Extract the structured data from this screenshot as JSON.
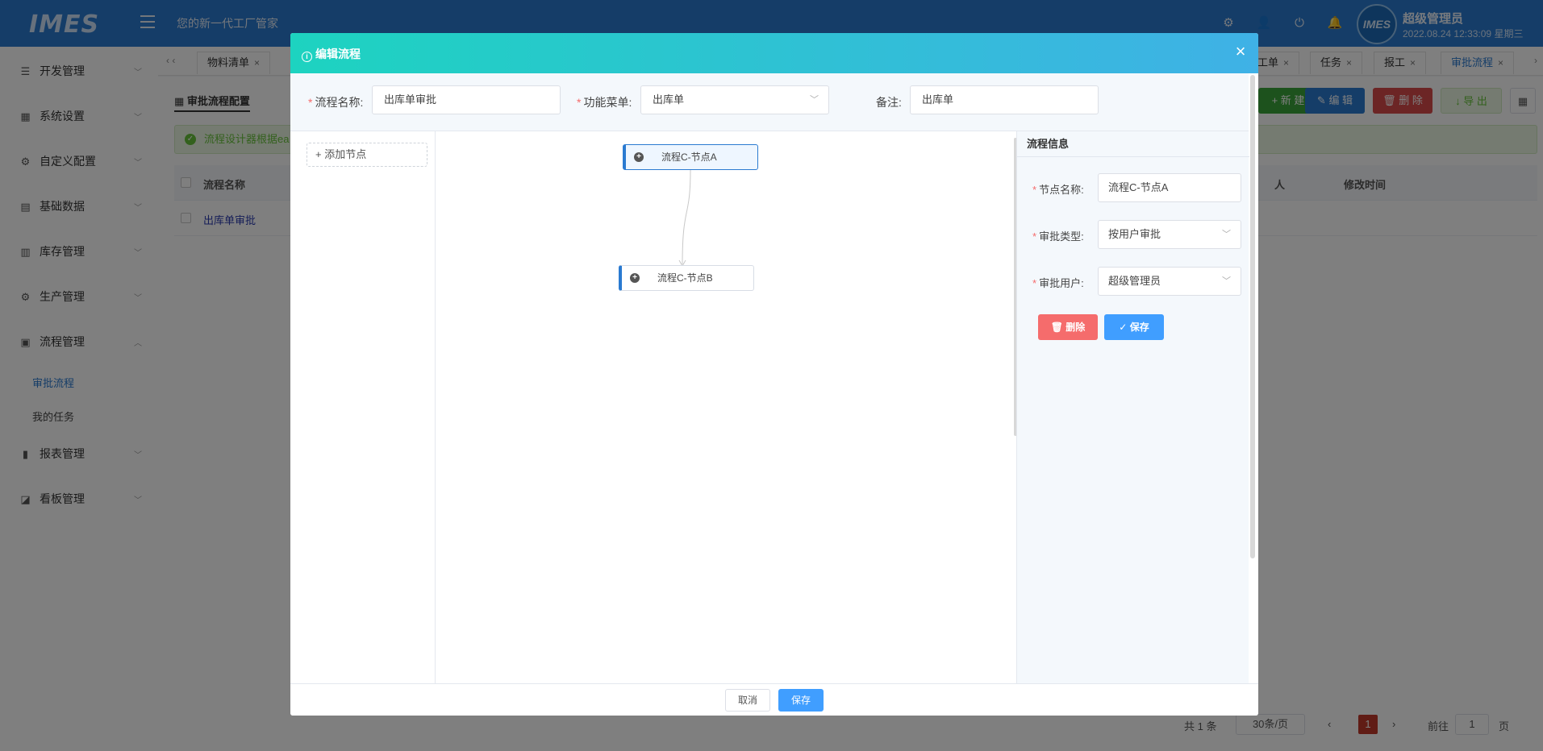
{
  "header": {
    "logo": "IMES",
    "slogan": "您的新一代工厂管家",
    "user_name": "超级管理员",
    "user_time": "2022.08.24 12:33:09 星期三",
    "avatar_text": "IMES"
  },
  "sidebar": {
    "items": [
      {
        "label": "开发管理"
      },
      {
        "label": "系统设置"
      },
      {
        "label": "自定义配置"
      },
      {
        "label": "基础数据"
      },
      {
        "label": "库存管理"
      },
      {
        "label": "生产管理"
      },
      {
        "label": "流程管理"
      },
      {
        "label": "报表管理"
      },
      {
        "label": "看板管理"
      }
    ],
    "sub_items": [
      {
        "label": "审批流程"
      },
      {
        "label": "我的任务"
      }
    ]
  },
  "tabs": {
    "left": [
      "物料清单"
    ],
    "right": [
      "工单",
      "任务",
      "报工",
      "审批流程"
    ]
  },
  "page": {
    "title": "审批流程配置",
    "alert": "流程设计器根据ea",
    "toolbar": {
      "new": "新 建",
      "edit": "编 辑",
      "delete": "删 除",
      "export": "导 出"
    },
    "table_headers": {
      "name": "流程名称",
      "person": "人",
      "modified": "修改时间"
    },
    "rows": [
      {
        "name": "出库单审批"
      }
    ],
    "pager": {
      "total": "共 1 条",
      "size": "30条/页",
      "current": "1",
      "goto": "前往",
      "goto_value": "1",
      "page_unit": "页"
    }
  },
  "modal": {
    "title": "编辑流程",
    "form": {
      "name_label": "流程名称:",
      "name_value": "出库单审批",
      "menu_label": "功能菜单:",
      "menu_value": "出库单",
      "remark_label": "备注:",
      "remark_value": "出库单"
    },
    "add_node": "添加节点",
    "nodes": [
      {
        "label": "流程C-节点A"
      },
      {
        "label": "流程C-节点B"
      }
    ],
    "info_panel": {
      "title": "流程信息",
      "node_name_label": "节点名称:",
      "node_name_value": "流程C-节点A",
      "approve_type_label": "审批类型:",
      "approve_type_value": "按用户审批",
      "approve_user_label": "审批用户:",
      "approve_user_value": "超级管理员",
      "delete_btn": "删除",
      "save_btn": "保存"
    },
    "footer": {
      "cancel": "取消",
      "save": "保存"
    }
  },
  "colors": {
    "primary": "#2a7ad1",
    "header_grad_start": "#1dd3c0",
    "header_grad_end": "#3fb1e6",
    "danger": "#f56c6c",
    "save": "#409eff"
  }
}
